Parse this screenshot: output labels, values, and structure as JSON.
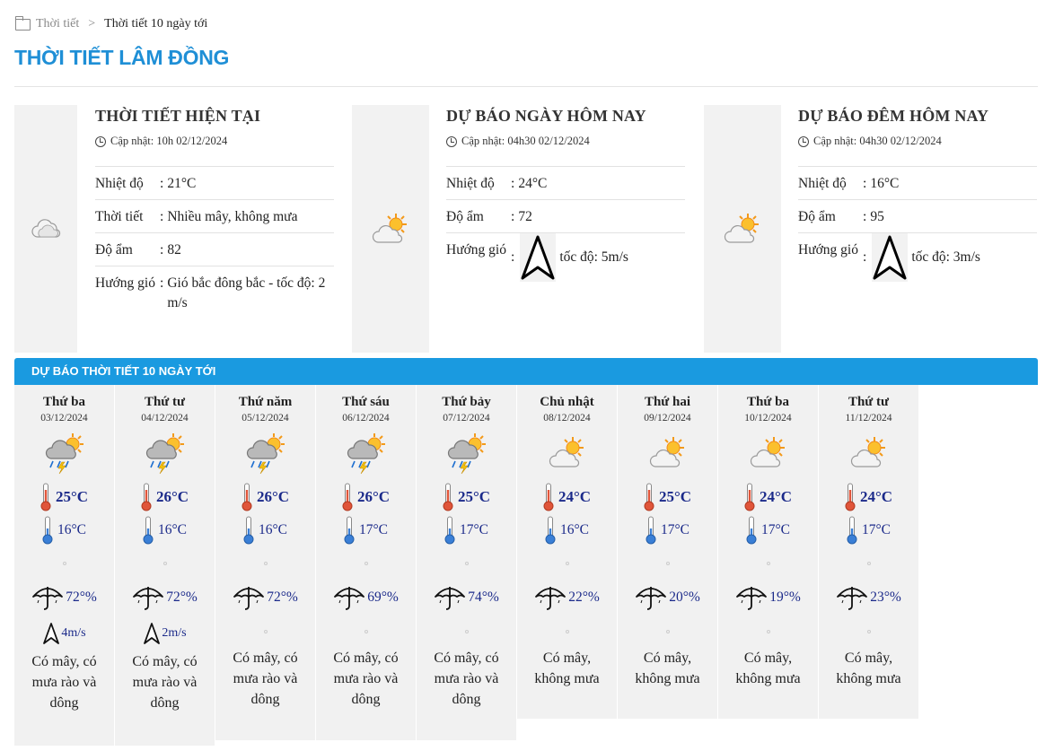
{
  "breadcrumb": {
    "home": "Thời tiết",
    "separator": ">",
    "current": "Thời tiết 10 ngày tới"
  },
  "page_title": "THỜI TIẾT LÂM ĐỒNG",
  "current": {
    "title": "THỜI TIẾT HIỆN TẠI",
    "updated": "Cập nhật: 10h 02/12/2024",
    "icon": "cloud-icon",
    "rows": [
      {
        "label": "Nhiệt độ",
        "value": "21°C"
      },
      {
        "label": "Thời tiết",
        "value": "Nhiều mây, không mưa"
      },
      {
        "label": "Độ ẩm",
        "value": "82"
      },
      {
        "label": "Hướng gió",
        "value": "Gió bắc đông bắc - tốc độ: 2 m/s"
      }
    ]
  },
  "today": {
    "title": "DỰ BÁO NGÀY HÔM NAY",
    "updated": "Cập nhật: 04h30 02/12/2024",
    "icon": "sun-cloud-icon",
    "rows": [
      {
        "label": "Nhiệt độ",
        "value": "24°C"
      },
      {
        "label": "Độ ẩm",
        "value": "72"
      },
      {
        "label": "Hướng gió",
        "value": "tốc độ: 5m/s"
      }
    ]
  },
  "tonight": {
    "title": "DỰ BÁO ĐÊM HÔM NAY",
    "updated": "Cập nhật: 04h30 02/12/2024",
    "icon": "sun-cloud-icon",
    "rows": [
      {
        "label": "Nhiệt độ",
        "value": "16°C"
      },
      {
        "label": "Độ ẩm",
        "value": "95"
      },
      {
        "label": "Hướng gió",
        "value": "tốc độ: 3m/s"
      }
    ]
  },
  "forecast_title": "DỰ BÁO THỜI TIẾT 10 NGÀY TỚI",
  "days": [
    {
      "name": "Thứ ba",
      "date": "03/12/2024",
      "icon": "storm",
      "hi": "25°C",
      "lo": "16°C",
      "rain": "72°%",
      "wind": "4m/s",
      "desc": "Có mây, có mưa rào và dông"
    },
    {
      "name": "Thứ tư",
      "date": "04/12/2024",
      "icon": "storm",
      "hi": "26°C",
      "lo": "16°C",
      "rain": "72°%",
      "wind": "2m/s",
      "desc": "Có mây, có mưa rào và dông"
    },
    {
      "name": "Thứ năm",
      "date": "05/12/2024",
      "icon": "storm",
      "hi": "26°C",
      "lo": "16°C",
      "rain": "72°%",
      "wind": "",
      "desc": "Có mây, có mưa rào và dông"
    },
    {
      "name": "Thứ sáu",
      "date": "06/12/2024",
      "icon": "storm",
      "hi": "26°C",
      "lo": "17°C",
      "rain": "69°%",
      "wind": "",
      "desc": "Có mây, có mưa rào và dông"
    },
    {
      "name": "Thứ bảy",
      "date": "07/12/2024",
      "icon": "storm",
      "hi": "25°C",
      "lo": "17°C",
      "rain": "74°%",
      "wind": "",
      "desc": "Có mây, có mưa rào và dông"
    },
    {
      "name": "Chủ nhật",
      "date": "08/12/2024",
      "icon": "suncloud",
      "hi": "24°C",
      "lo": "16°C",
      "rain": "22°%",
      "wind": "",
      "desc": "Có mây, không mưa"
    },
    {
      "name": "Thứ hai",
      "date": "09/12/2024",
      "icon": "suncloud",
      "hi": "25°C",
      "lo": "17°C",
      "rain": "20°%",
      "wind": "",
      "desc": "Có mây, không mưa"
    },
    {
      "name": "Thứ ba",
      "date": "10/12/2024",
      "icon": "suncloud",
      "hi": "24°C",
      "lo": "17°C",
      "rain": "19°%",
      "wind": "",
      "desc": "Có mây, không mưa"
    },
    {
      "name": "Thứ tư",
      "date": "11/12/2024",
      "icon": "suncloud",
      "hi": "24°C",
      "lo": "17°C",
      "rain": "23°%",
      "wind": "",
      "desc": "Có mây, không mưa"
    }
  ]
}
